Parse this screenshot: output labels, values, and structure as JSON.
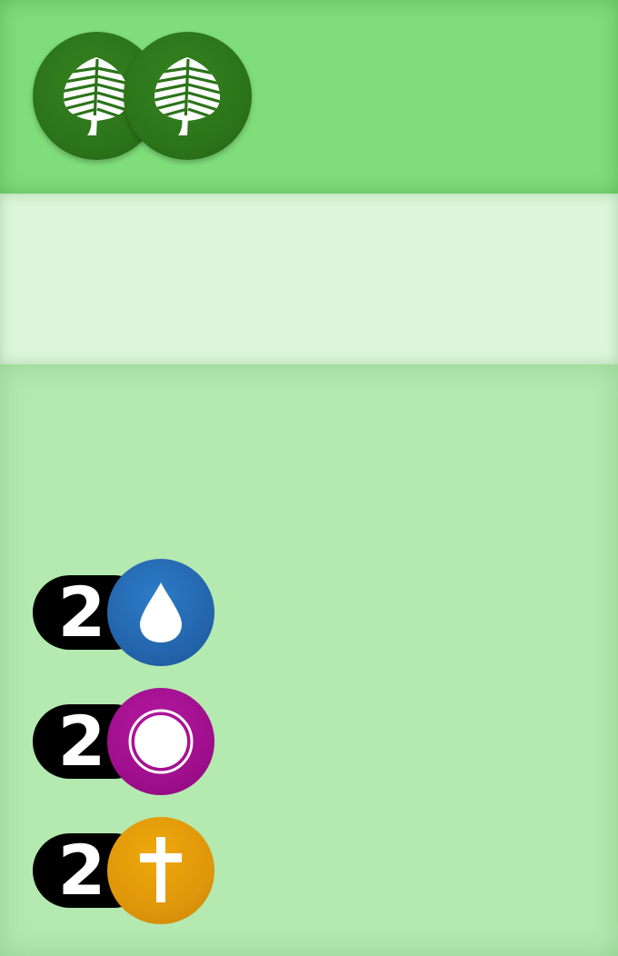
{
  "card": {
    "cost_icons": [
      {
        "icon": "tree-icon",
        "color": "#2b7319"
      },
      {
        "icon": "tree-icon",
        "color": "#2b7319"
      }
    ],
    "text_box": "",
    "resources": [
      {
        "count": "2",
        "icon": "water-drop-icon",
        "color": "#2466ad"
      },
      {
        "count": "2",
        "icon": "circle-ring-icon",
        "color": "#9e0e8b"
      },
      {
        "count": "2",
        "icon": "cross-icon",
        "color": "#df970b"
      }
    ]
  },
  "colors": {
    "header": "#7fde79",
    "text_band": "#dcf6db",
    "body": "#b4e9b0"
  }
}
